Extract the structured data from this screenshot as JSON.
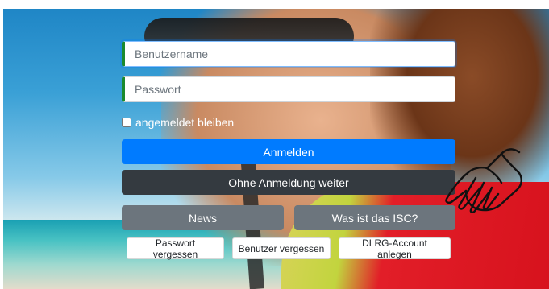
{
  "login": {
    "username_placeholder": "Benutzername",
    "password_placeholder": "Passwort",
    "remember_label": "angemeldet bleiben",
    "login_button": "Anmelden",
    "guest_button": "Ohne Anmeldung weiter",
    "news_button": "News",
    "about_button": "Was ist das ISC?",
    "forgot_password": "Passwort vergessen",
    "forgot_user": "Benutzer vergessen",
    "create_account": "DLRG-Account anlegen"
  },
  "icons": {
    "pointer": "pointing-hand-icon"
  },
  "colors": {
    "primary": "#007bff",
    "dark": "#343a40",
    "secondary": "#6c757d",
    "field_accent": "#1b8a2e"
  }
}
